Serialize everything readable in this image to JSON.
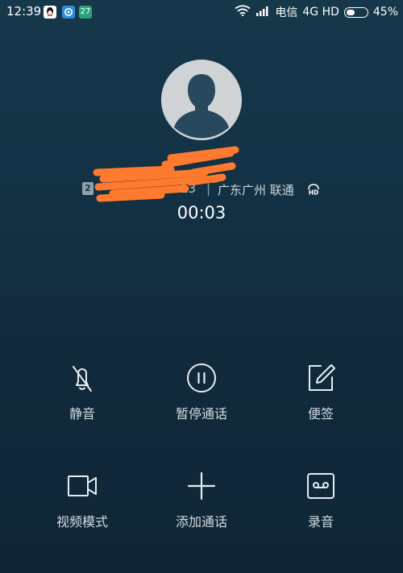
{
  "status_bar": {
    "time": "12:39",
    "notification_badge": "27",
    "carrier": "电信",
    "network": "4G HD",
    "battery_text": "45%",
    "battery_level": 0.45
  },
  "caller": {
    "sim_slot": "2",
    "number_tail": "13",
    "separator": "|",
    "location": "广东广州 联通",
    "duration": "00:03"
  },
  "actions": {
    "mute_label": "静音",
    "hold_label": "暂停通话",
    "note_label": "便签",
    "video_label": "视频模式",
    "add_call_label": "添加通话",
    "record_label": "录音"
  },
  "colors": {
    "background_top": "#16384a",
    "background_bottom": "#102637",
    "icon_stroke": "#e6edf1",
    "redaction": "#ff7a2e"
  },
  "icons": {
    "mute": "mic-off-icon",
    "hold": "pause-icon",
    "note": "note-edit-icon",
    "video": "video-camera-icon",
    "add_call": "plus-icon",
    "record": "cassette-icon"
  }
}
